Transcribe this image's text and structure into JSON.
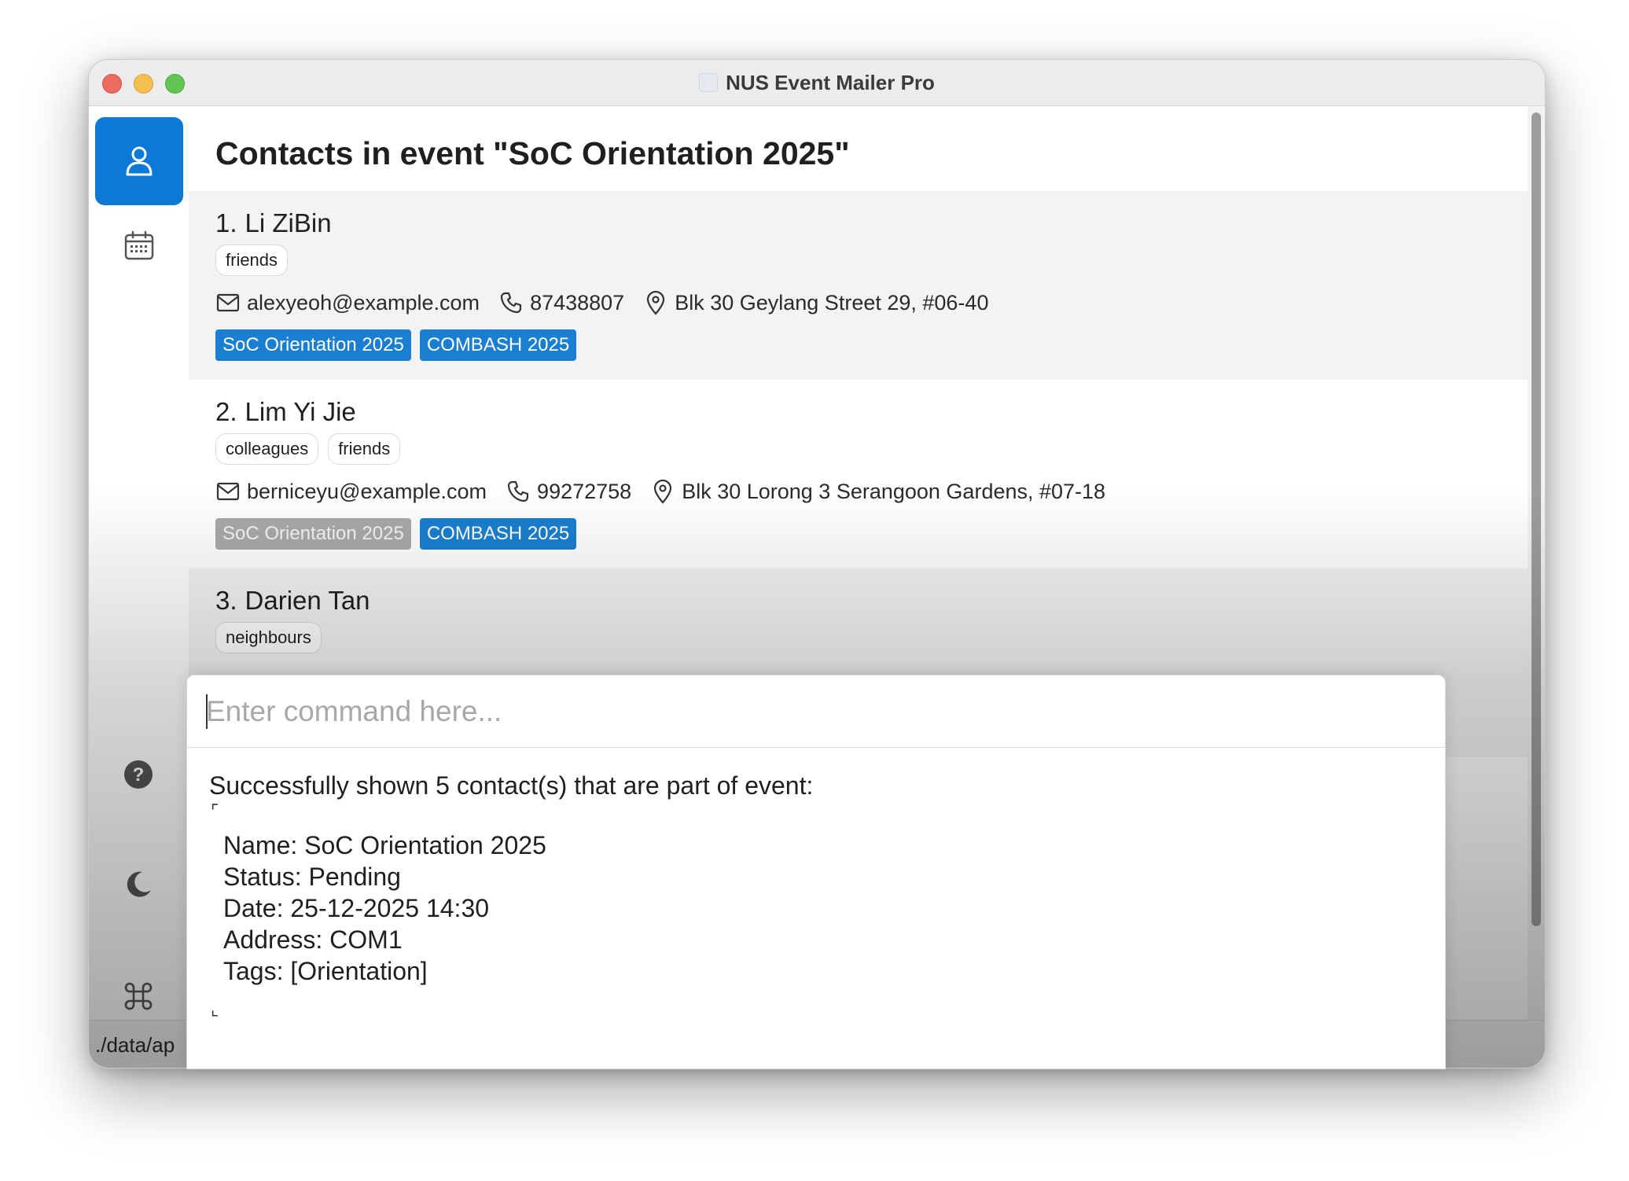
{
  "window": {
    "title": "NUS Event Mailer Pro"
  },
  "sidebar": {
    "items": [
      {
        "name": "contacts",
        "icon": "person-icon",
        "active": true
      },
      {
        "name": "events",
        "icon": "calendar-icon",
        "active": false
      },
      {
        "name": "help",
        "icon": "help-icon"
      },
      {
        "name": "theme",
        "icon": "moon-icon"
      },
      {
        "name": "commands",
        "icon": "command-icon"
      }
    ]
  },
  "main": {
    "title": "Contacts in event \"SoC Orientation 2025\"",
    "contacts": [
      {
        "index": "1.",
        "name": "Li ZiBin",
        "tags": [
          "friends"
        ],
        "email": "alexyeoh@example.com",
        "phone": "87438807",
        "address": "Blk 30 Geylang Street 29, #06-40",
        "events": [
          "SoC Orientation 2025",
          "COMBASH 2025"
        ]
      },
      {
        "index": "2.",
        "name": "Lim Yi Jie",
        "tags": [
          "colleagues",
          "friends"
        ],
        "email": "berniceyu@example.com",
        "phone": "99272758",
        "address": "Blk 30 Lorong 3 Serangoon Gardens, #07-18",
        "events": [
          "SoC Orientation 2025",
          "COMBASH 2025"
        ]
      },
      {
        "index": "3.",
        "name": "Darien Tan",
        "tags": [
          "neighbours"
        ]
      }
    ]
  },
  "command": {
    "placeholder": "Enter command here...",
    "result_header": "Successfully shown 5 contact(s) that are part of event:",
    "bracket_open": "⌜",
    "bracket_close": "⌞",
    "details": [
      "Name: SoC Orientation 2025",
      "Status: Pending",
      "Date: 25-12-2025 14:30",
      "Address: COM1",
      "Tags: [Orientation]"
    ]
  },
  "status_bar": {
    "path": "./data/ap"
  },
  "colors": {
    "accent": "#0a7ad6",
    "event_tag": "#1a7fd0",
    "event_tag_muted": "#a9a9a9"
  }
}
